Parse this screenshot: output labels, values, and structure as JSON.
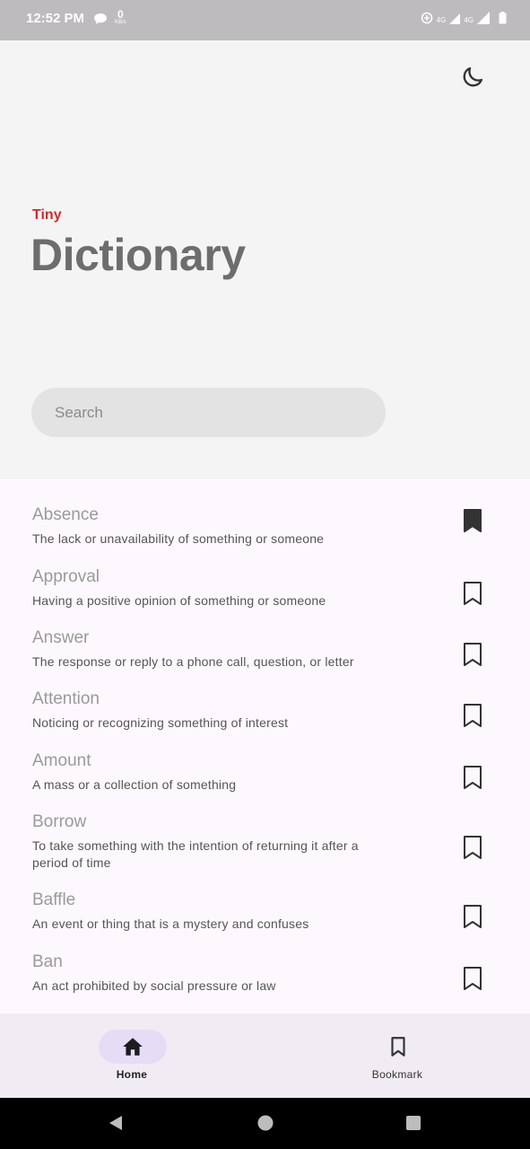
{
  "status": {
    "time": "12:52 PM",
    "speed_value": "0",
    "speed_unit": "KB/s",
    "net1": "4G",
    "net2": "4G"
  },
  "header": {
    "kicker": "Tiny",
    "title": "Dictionary"
  },
  "search": {
    "placeholder": "Search",
    "value": ""
  },
  "words": [
    {
      "word": "Absence",
      "definition": "The lack or unavailability of something or someone",
      "bookmarked": true
    },
    {
      "word": "Approval",
      "definition": "Having a positive opinion of something or someone",
      "bookmarked": false
    },
    {
      "word": "Answer",
      "definition": "The response or reply to a phone call, question, or letter",
      "bookmarked": false
    },
    {
      "word": "Attention",
      "definition": "Noticing or recognizing something of interest",
      "bookmarked": false
    },
    {
      "word": "Amount",
      "definition": "A mass or a collection of something",
      "bookmarked": false
    },
    {
      "word": "Borrow",
      "definition": "To take something with the intention of returning it after a period of time",
      "bookmarked": false
    },
    {
      "word": "Baffle",
      "definition": "An event or thing that is a mystery and confuses",
      "bookmarked": false
    },
    {
      "word": "Ban",
      "definition": "An act prohibited by social pressure or law",
      "bookmarked": false
    }
  ],
  "nav": {
    "home_label": "Home",
    "bookmark_label": "Bookmark",
    "active": "home"
  },
  "colors": {
    "accent": "#d22a2a",
    "title": "#6d6d6d",
    "nav_pill": "#e7dcf6"
  }
}
